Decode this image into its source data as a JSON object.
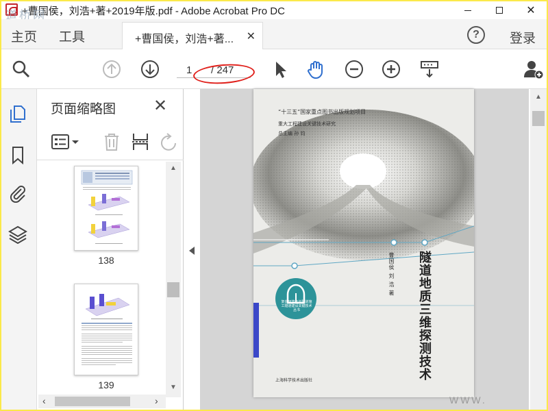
{
  "window": {
    "title": "+曹国侯，刘浩+著+2019年版.pdf - Adobe Acrobat Pro DC",
    "watermark": "道桥网",
    "minimize_label": "",
    "close_label": "✕"
  },
  "menu": {
    "home": "主页",
    "tools": "工具",
    "doc_tab_label": "+曹国侯，刘浩+著...",
    "doc_tab_close": "✕",
    "help": "?",
    "login": "登录"
  },
  "toolbar": {
    "current_page": "1",
    "total_pages": "/ 247"
  },
  "thumbnails_panel": {
    "title": "页面缩略图",
    "close": "✕",
    "pages": [
      {
        "number": "138"
      },
      {
        "number": "139"
      }
    ]
  },
  "cover": {
    "series_line": "“十三五”国家重点图书出版规划项目",
    "subseries_line": "重大工程建设关键技术研究",
    "chief_editor": "总主编  孙  钧",
    "title_vertical": "隧道地质三维探测技术",
    "authors_vertical": "曹国侯    刘    浩    著",
    "badge_text": "复杂环境与长隧道施工隧道建设关键技术丛书",
    "publisher": "上海科学技术出版社"
  },
  "bottom_watermark": "WWW.",
  "colors": {
    "frame_border": "#fbe94a",
    "accent_blue": "#2f6fce",
    "adobe_red": "#c4242b",
    "annotation_red": "#e0201b",
    "cover_teal": "#2d9399",
    "cover_vertical_band": "#3a47c8"
  }
}
